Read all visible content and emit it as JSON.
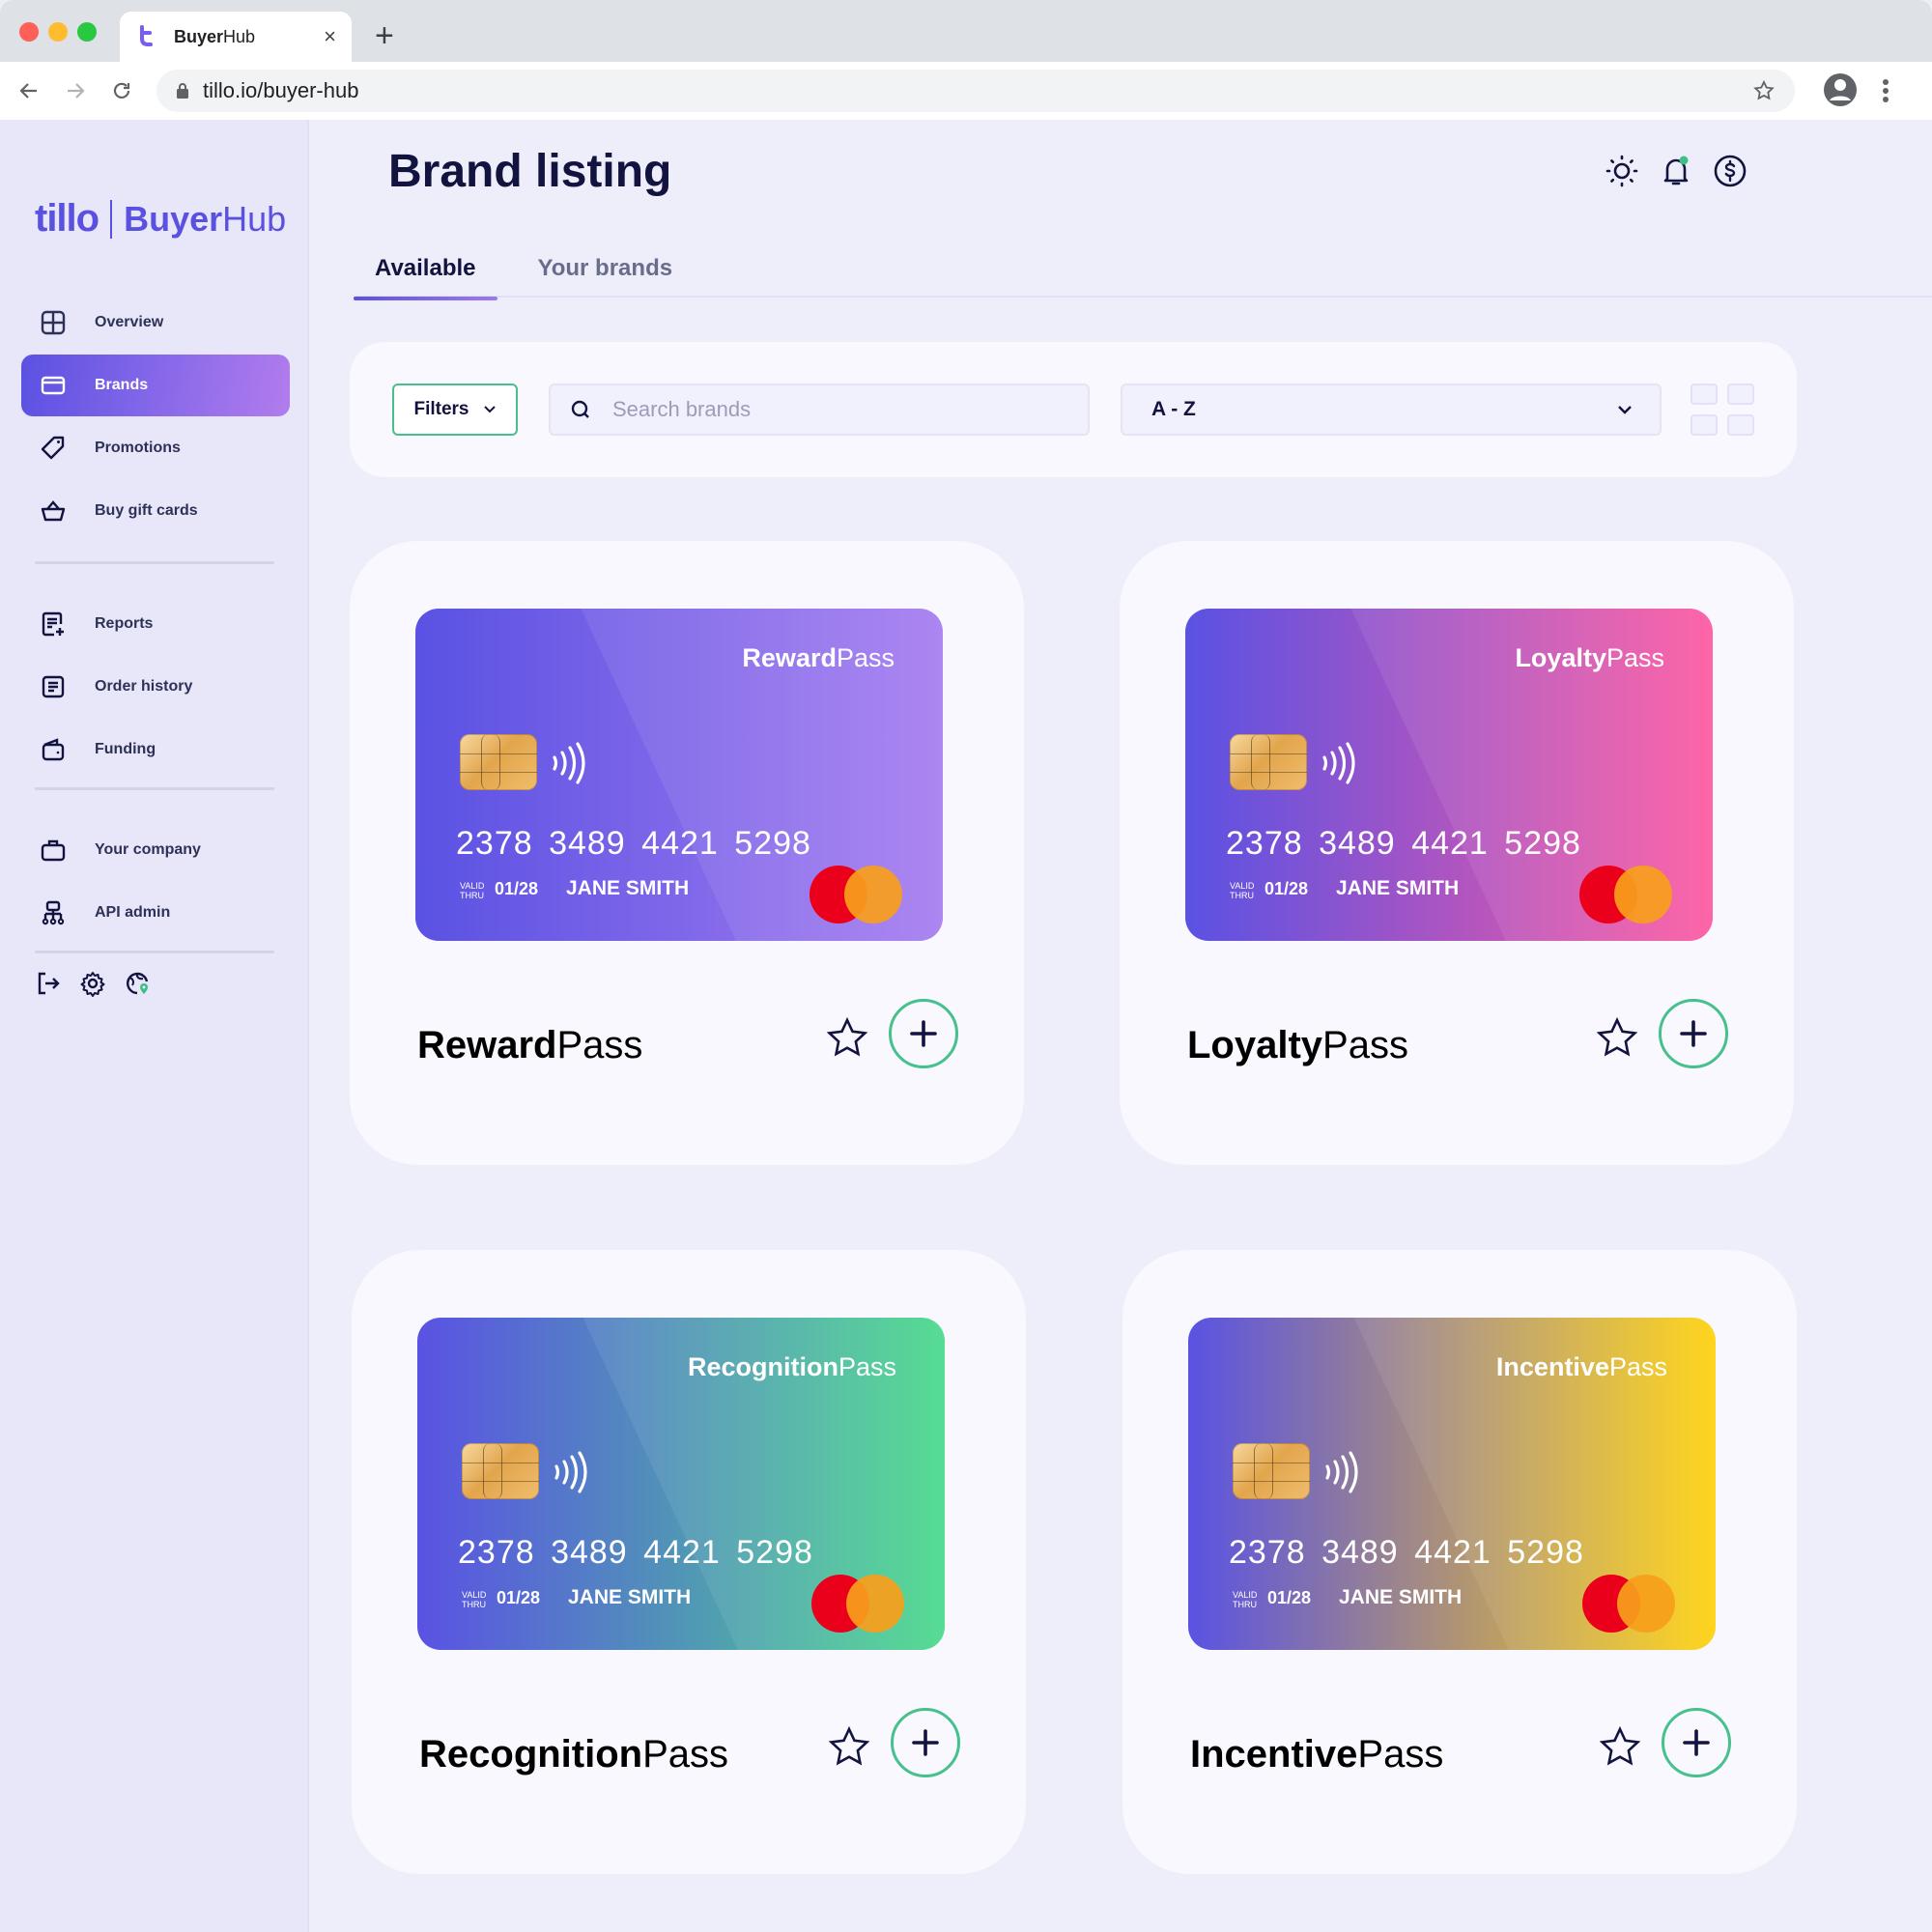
{
  "browser": {
    "tab": {
      "title_bold": "Buyer",
      "title_regular": "Hub",
      "close_glyph": "×"
    },
    "new_tab_glyph": "+",
    "url": "tillo.io/buyer-hub"
  },
  "sidebar": {
    "logo": {
      "tillo": "tillo",
      "buyer": "Buyer",
      "hub": "Hub",
      "brand_color": "#5b51e0"
    },
    "groups": [
      [
        {
          "label": "Overview",
          "icon": "grid-icon",
          "active": false
        },
        {
          "label": "Brands",
          "icon": "card-icon",
          "active": true
        },
        {
          "label": "Promotions",
          "icon": "tag-icon",
          "active": false
        },
        {
          "label": "Buy gift cards",
          "icon": "basket-icon",
          "active": false
        }
      ],
      [
        {
          "label": "Reports",
          "icon": "report-add-icon",
          "active": false
        },
        {
          "label": "Order history",
          "icon": "document-icon",
          "active": false
        },
        {
          "label": "Funding",
          "icon": "wallet-icon",
          "active": false
        }
      ],
      [
        {
          "label": "Your company",
          "icon": "briefcase-icon",
          "active": false
        },
        {
          "label": "API admin",
          "icon": "hierarchy-icon",
          "active": false
        }
      ]
    ],
    "bottom_icons": [
      "logout-icon",
      "settings-icon",
      "globe-location-icon"
    ]
  },
  "header": {
    "title": "Brand listing",
    "icons": [
      "sun-icon",
      "bell-icon",
      "dollar-circle-icon"
    ],
    "notification_dot_color": "#3fbf85"
  },
  "tabs": [
    {
      "label": "Available",
      "active": true
    },
    {
      "label": "Your brands",
      "active": false
    }
  ],
  "filterbar": {
    "filters_label": "Filters",
    "search_placeholder": "Search brands",
    "search_value": "",
    "sort_value": "A - Z"
  },
  "brands": [
    {
      "name_bold": "Reward",
      "name_regular": "Pass",
      "card_number": "2378 3489 4421 5298",
      "valid_label_1": "VALID",
      "valid_label_2": "THRU",
      "expiry": "01/28",
      "holder": "JANE SMITH",
      "gradient": [
        "#5a52e3",
        "#a57cf0"
      ]
    },
    {
      "name_bold": "Loyalty",
      "name_regular": "Pass",
      "card_number": "2378 3489 4421 5298",
      "valid_label_1": "VALID",
      "valid_label_2": "THRU",
      "expiry": "01/28",
      "holder": "JANE SMITH",
      "gradient": [
        "#5a52e3",
        "#fe58a0"
      ]
    },
    {
      "name_bold": "Recognition",
      "name_regular": "Pass",
      "card_number": "2378 3489 4421 5298",
      "valid_label_1": "VALID",
      "valid_label_2": "THRU",
      "expiry": "01/28",
      "holder": "JANE SMITH",
      "gradient": [
        "#5a52e3",
        "#48d98a"
      ]
    },
    {
      "name_bold": "Incentive",
      "name_regular": "Pass",
      "card_number": "2378 3489 4421 5298",
      "valid_label_1": "VALID",
      "valid_label_2": "THRU",
      "expiry": "01/28",
      "holder": "JANE SMITH",
      "gradient": [
        "#5a52e3",
        "#ffd20c"
      ]
    }
  ],
  "colors": {
    "accent_green": "#47c08d",
    "text_dark": "#12133f",
    "page_bg": "#eeeefb"
  }
}
